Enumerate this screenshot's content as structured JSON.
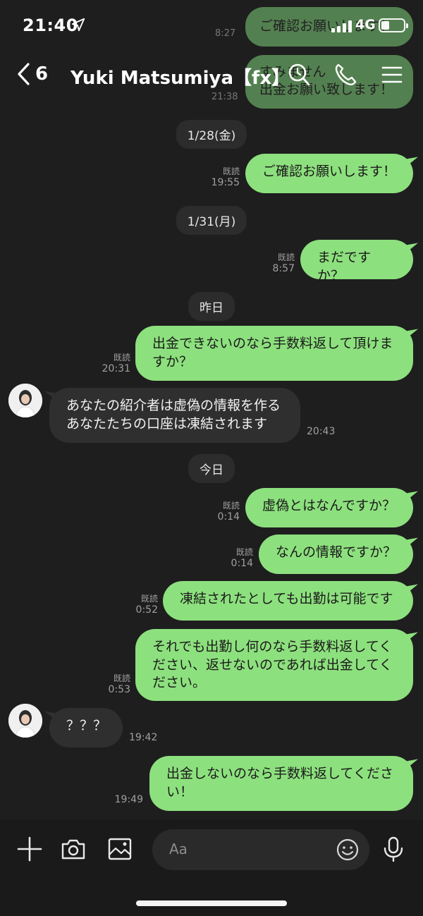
{
  "status_bar": {
    "time": "21:40",
    "network": "4G"
  },
  "header": {
    "back_count": "6",
    "title": "Yuki  Matsumiya【fx】"
  },
  "ghost": {
    "msg1": "ご確認お願いします！",
    "msg2a": "すみません",
    "msg2b": "出金お願い致します！",
    "time1": "8:27",
    "time2": "21:38"
  },
  "messages": [
    {
      "type": "date",
      "text": "1/28(金)"
    },
    {
      "type": "out",
      "text": "ご確認お願いします！",
      "read": "既読",
      "time": "19:55"
    },
    {
      "type": "date",
      "text": "1/31(月)"
    },
    {
      "type": "out",
      "text": "まだですか？",
      "read": "既読",
      "time": "8:57"
    },
    {
      "type": "date",
      "text": "昨日"
    },
    {
      "type": "out",
      "line1": "出金できないのなら手数料返して頂けま",
      "line2": "すか？",
      "read": "既読",
      "time": "20:31"
    },
    {
      "type": "in",
      "line1": "あなたの紹介者は虚偽の情報を作る",
      "line2": "あなたたちの口座は凍結されます",
      "time": "20:43"
    },
    {
      "type": "date",
      "text": "今日"
    },
    {
      "type": "out",
      "text": "虚偽とはなんですか？",
      "read": "既読",
      "time": "0:14"
    },
    {
      "type": "out",
      "text": "なんの情報ですか？",
      "read": "既読",
      "time": "0:14"
    },
    {
      "type": "out",
      "text": "凍結されたとしても出勤は可能です",
      "read": "既読",
      "time": "0:52"
    },
    {
      "type": "out",
      "line1": "それでも出勤し何のなら手数料返してく",
      "line2": "ださい、返せないのであれば出金してく",
      "line3": "ださい。",
      "read": "既読",
      "time": "0:53"
    },
    {
      "type": "in",
      "text": "？？？",
      "time": "19:42"
    },
    {
      "type": "out",
      "line1": "出金しないのなら手数料返してくださ",
      "line2": "い！",
      "time": "19:49"
    }
  ],
  "input": {
    "placeholder": "Aa"
  },
  "icons": {
    "back": "chevron-left-icon",
    "search": "search-icon",
    "call": "phone-icon",
    "menu": "menu-icon",
    "plus": "plus-icon",
    "camera": "camera-icon",
    "image": "image-icon",
    "emoji": "emoji-icon",
    "mic": "mic-icon"
  },
  "colors": {
    "background": "#1e1e1e",
    "outgoing_bubble": "#8de07e",
    "incoming_bubble": "#2f2f2f"
  }
}
